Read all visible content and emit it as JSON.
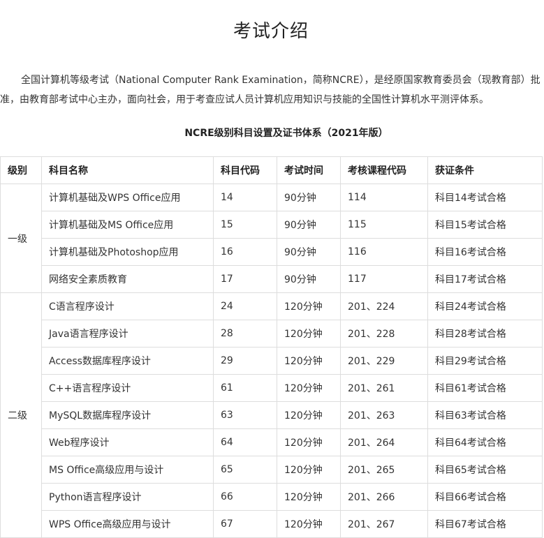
{
  "page": {
    "title": "考试介绍",
    "intro": "全国计算机等级考试（National Computer Rank Examination，简称NCRE），是经原国家教育委员会（现教育部）批准，由教育部考试中心主办，面向社会，用于考查应试人员计算机应用知识与技能的全国性计算机水平测评体系。",
    "table_title": "NCRE级别科目设置及证书体系（2021年版）"
  },
  "table": {
    "headers": [
      "级别",
      "科目名称",
      "科目代码",
      "考试时间",
      "考核课程代码",
      "获证条件"
    ],
    "groups": [
      {
        "level": "一级",
        "rows": [
          {
            "name": "计算机基础及WPS Office应用",
            "code": "14",
            "time": "90分钟",
            "course": "114",
            "condition": "科目14考试合格"
          },
          {
            "name": "计算机基础及MS Office应用",
            "code": "15",
            "time": "90分钟",
            "course": "115",
            "condition": "科目15考试合格"
          },
          {
            "name": "计算机基础及Photoshop应用",
            "code": "16",
            "time": "90分钟",
            "course": "116",
            "condition": "科目16考试合格"
          },
          {
            "name": "网络安全素质教育",
            "code": "17",
            "time": "90分钟",
            "course": "117",
            "condition": "科目17考试合格"
          }
        ]
      },
      {
        "level": "二级",
        "rows": [
          {
            "name": "C语言程序设计",
            "code": "24",
            "time": "120分钟",
            "course": "201、224",
            "condition": "科目24考试合格"
          },
          {
            "name": "Java语言程序设计",
            "code": "28",
            "time": "120分钟",
            "course": "201、228",
            "condition": "科目28考试合格"
          },
          {
            "name": "Access数据库程序设计",
            "code": "29",
            "time": "120分钟",
            "course": "201、229",
            "condition": "科目29考试合格"
          },
          {
            "name": "C++语言程序设计",
            "code": "61",
            "time": "120分钟",
            "course": "201、261",
            "condition": "科目61考试合格"
          },
          {
            "name": "MySQL数据库程序设计",
            "code": "63",
            "time": "120分钟",
            "course": "201、263",
            "condition": "科目63考试合格"
          },
          {
            "name": "Web程序设计",
            "code": "64",
            "time": "120分钟",
            "course": "201、264",
            "condition": "科目64考试合格"
          },
          {
            "name": "MS Office高级应用与设计",
            "code": "65",
            "time": "120分钟",
            "course": "201、265",
            "condition": "科目65考试合格"
          },
          {
            "name": "Python语言程序设计",
            "code": "66",
            "time": "120分钟",
            "course": "201、266",
            "condition": "科目66考试合格"
          },
          {
            "name": "WPS Office高级应用与设计",
            "code": "67",
            "time": "120分钟",
            "course": "201、267",
            "condition": "科目67考试合格"
          }
        ]
      }
    ]
  }
}
